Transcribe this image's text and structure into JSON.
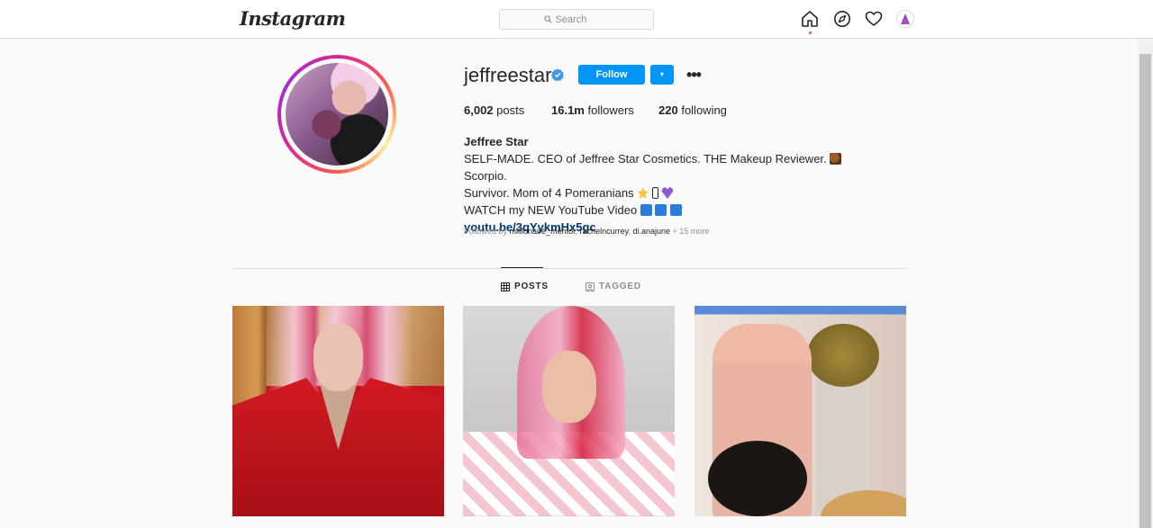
{
  "nav": {
    "logo": "Instagram",
    "search_placeholder": "Search",
    "icons": [
      "home-icon",
      "explore-icon",
      "heart-icon",
      "profile-avatar"
    ]
  },
  "profile": {
    "username": "jeffreestar",
    "verified": true,
    "follow_label": "Follow",
    "dropdown_label": "▾",
    "more_label": "•••",
    "stats": {
      "posts_count": "6,002",
      "posts_label": "posts",
      "followers_count": "16.1m",
      "followers_label": "followers",
      "following_count": "220",
      "following_label": "following"
    },
    "name": "Jeffree Star",
    "bio_line1": "SELF-MADE. CEO of Jeffree Star Cosmetics. THE Makeup Reviewer.",
    "bio_line1_tail": "Scorpio.",
    "bio_line2": "Survivor. Mom of 4 Pomeranians",
    "bio_line3": "WATCH my NEW YouTube Video",
    "link": "youtu.be/3qYykmHx5gc",
    "followed_by_prefix": "Followed by",
    "followed_by_users": [
      "millionaire_mentor",
      "rachelncurrey",
      "di.anajune"
    ],
    "followed_by_more": "+ 15 more"
  },
  "tabs": [
    {
      "label": "POSTS",
      "active": true
    },
    {
      "label": "TAGGED",
      "active": false
    }
  ],
  "colors": {
    "accent": "#0095f6",
    "link": "#00376b",
    "muted": "#8e8e8e"
  }
}
